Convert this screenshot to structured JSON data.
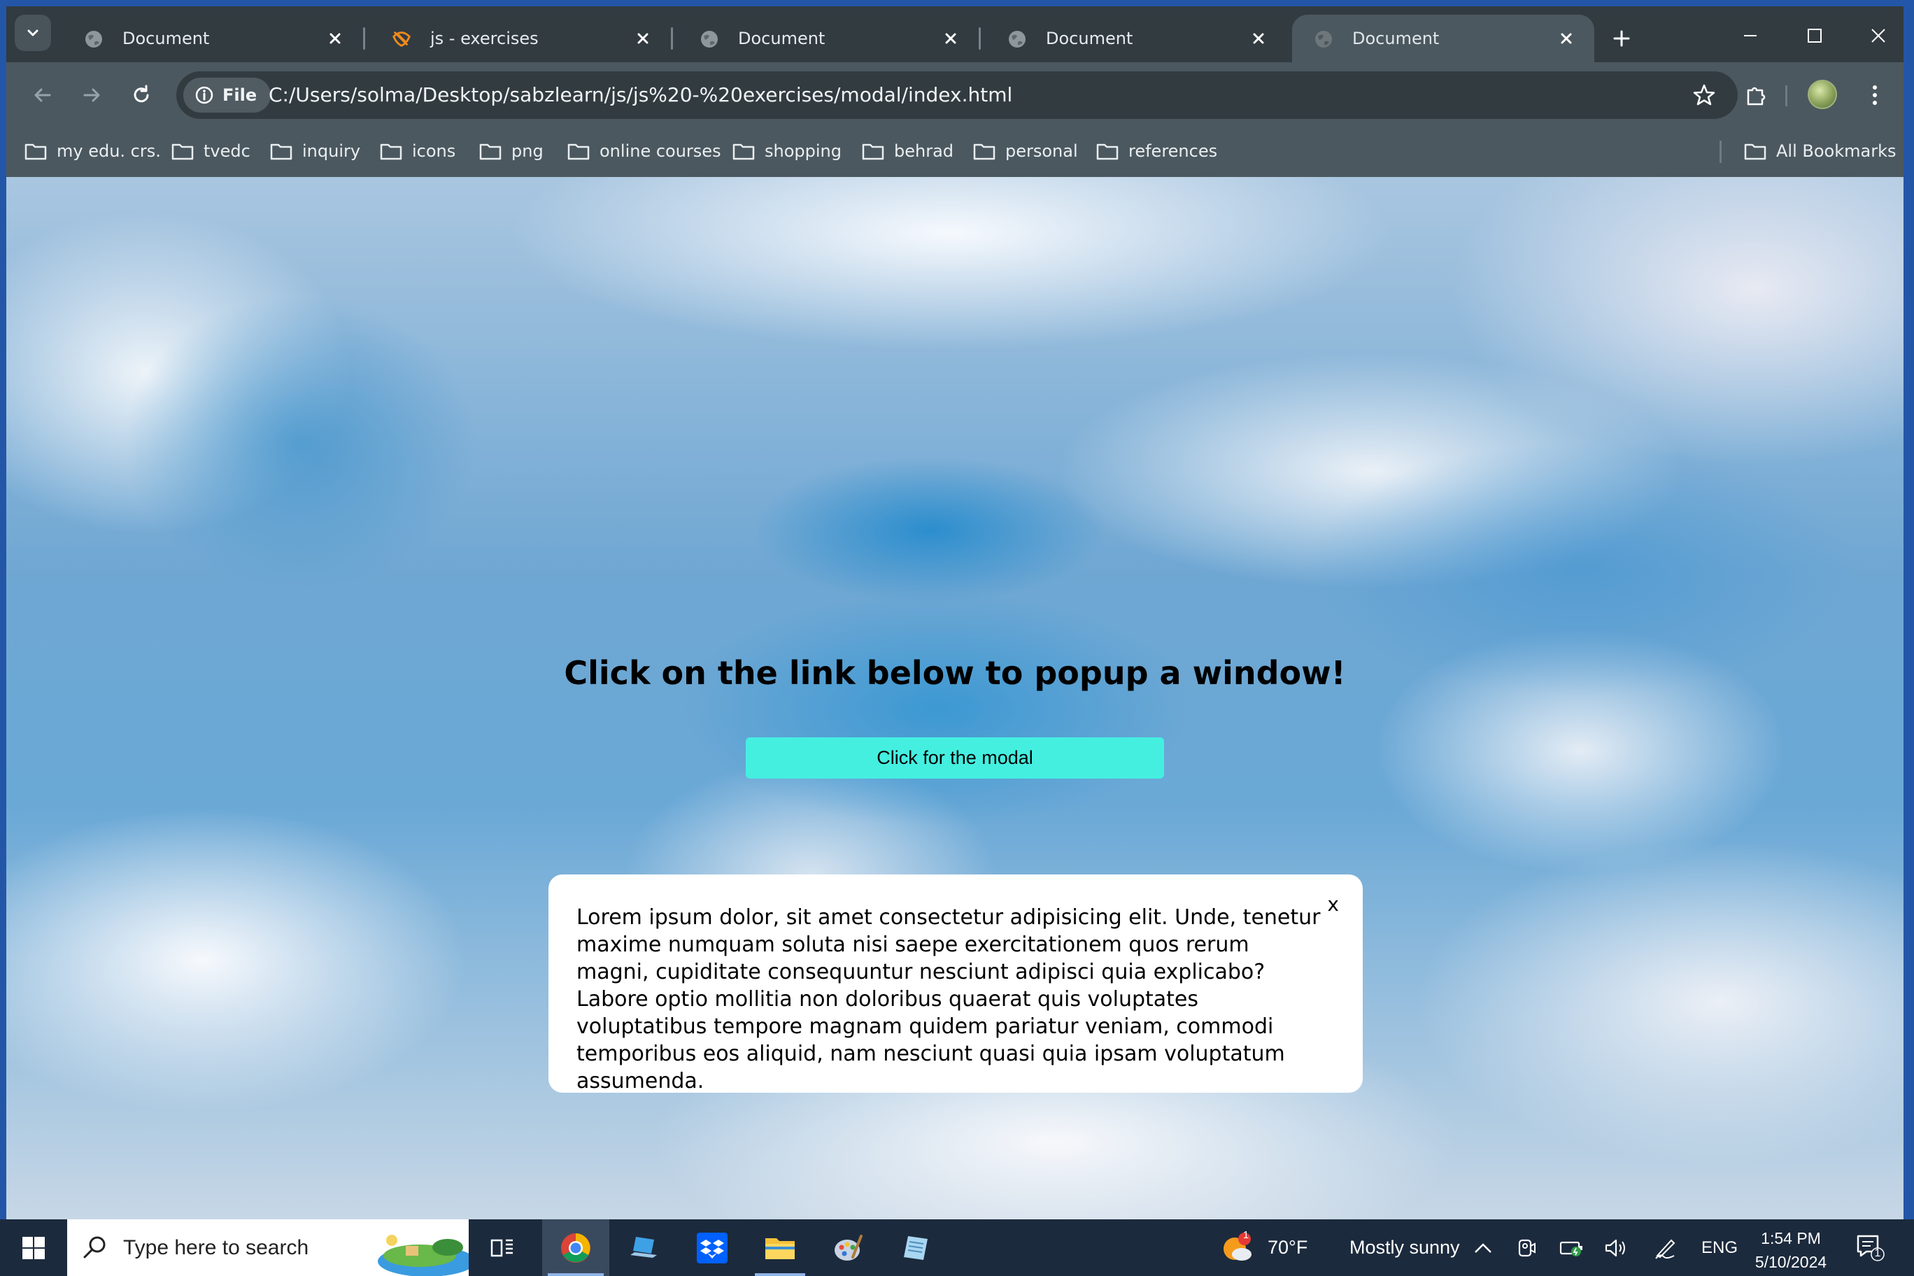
{
  "browser": {
    "tabs": [
      {
        "title": "Document",
        "favicon": "globe-icon",
        "active": false
      },
      {
        "title": "js - exercises",
        "favicon": "orange-logo-icon",
        "active": false
      },
      {
        "title": "Document",
        "favicon": "globe-icon",
        "active": false
      },
      {
        "title": "Document",
        "favicon": "globe-icon",
        "active": false
      },
      {
        "title": "Document",
        "favicon": "globe-icon",
        "active": true
      }
    ],
    "address_bar": {
      "scheme_chip": "File",
      "url": "C:/Users/solma/Desktop/sabzlearn/js/js%20-%20exercises/modal/index.html"
    },
    "bookmarks": [
      "my edu. crs.",
      "tvedc",
      "inquiry",
      "icons",
      "png",
      "online courses",
      "shopping",
      "behrad",
      "personal",
      "references"
    ],
    "all_bookmarks": "All Bookmarks"
  },
  "page": {
    "heading": "Click on the link below to popup a window!",
    "button_label": "Click for the modal",
    "modal": {
      "text": "Lorem ipsum dolor, sit amet consectetur adipisicing elit. Unde, tenetur maxime numquam soluta nisi saepe exercitationem quos rerum magni, cupiditate consequuntur nesciunt adipisci quia explicabo? Labore optio mollitia non doloribus quaerat quis voluptates voluptatibus tempore magnam quidem pariatur veniam, commodi temporibus eos aliquid, nam nesciunt quasi quia ipsam voluptatum assumenda.",
      "close_label": "x"
    }
  },
  "taskbar": {
    "search_placeholder": "Type here to search",
    "weather_temp": "70°F",
    "weather_desc": "Mostly sunny",
    "weather_badge": "1",
    "language": "ENG",
    "time": "1:54 PM",
    "date": "5/10/2024",
    "notification_count": "1"
  },
  "colors": {
    "tabstrip_bg": "#323b40",
    "toolbar_bg": "#4c585f",
    "button_bg": "#44efe0",
    "taskbar_bg": "#1c2a3d"
  }
}
